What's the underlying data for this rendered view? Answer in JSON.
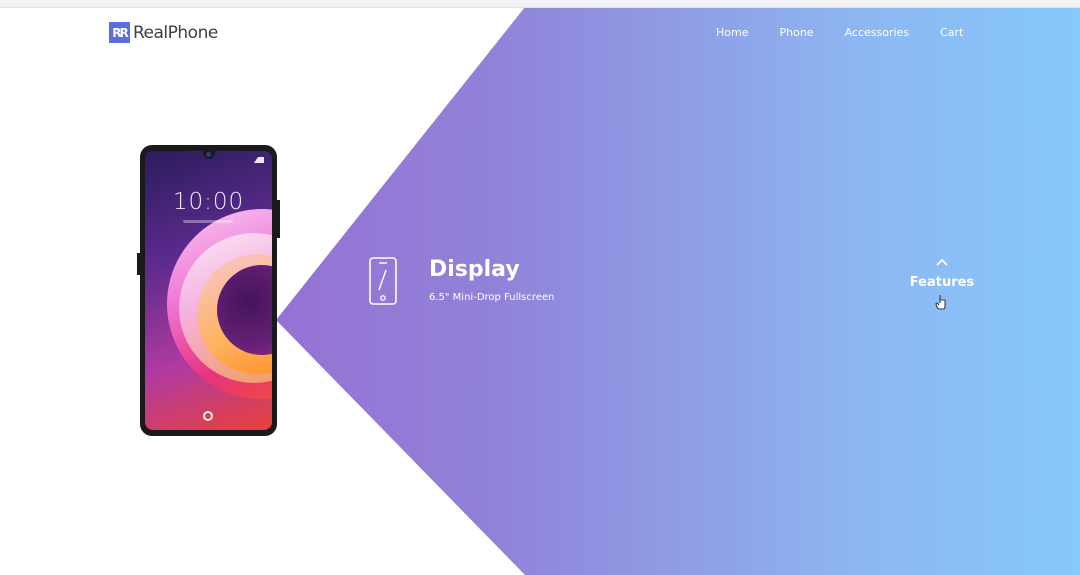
{
  "brand": {
    "logo_mark": "R",
    "name": "RealPhone"
  },
  "nav": {
    "items": [
      "Home",
      "Phone",
      "Accessories",
      "Cart"
    ]
  },
  "phone": {
    "time": "10:00"
  },
  "feature": {
    "icon": "smartphone-icon",
    "title": "Display",
    "description": "6.5\" Mini-Drop Fullscreen"
  },
  "features_nav": {
    "label": "Features",
    "icons": [
      "chevron-up-icon",
      "pointer-hand-icon"
    ]
  },
  "colors": {
    "gradient_start": "#9a5fcf",
    "gradient_end": "#86c9fb",
    "logo_accent": "#5b6fdc",
    "text_light": "#ffffff"
  }
}
